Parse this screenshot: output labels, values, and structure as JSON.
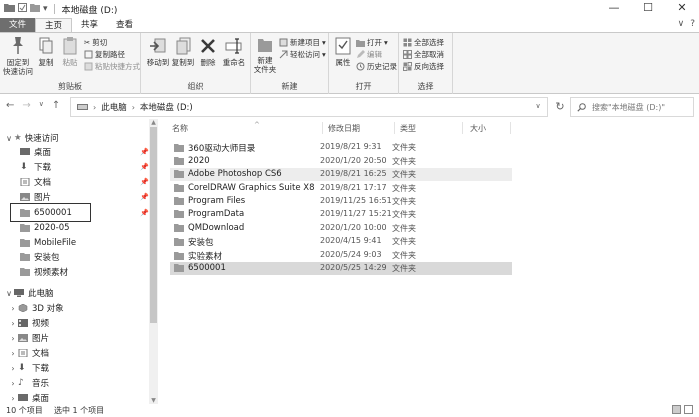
{
  "window": {
    "title": "本地磁盘 (D:)",
    "controls": [
      "—",
      "☐",
      "✕"
    ]
  },
  "quick_access_toolbar": [
    "save-icon",
    "properties-icon",
    "new-folder-icon"
  ],
  "tabs": [
    {
      "label": "文件"
    },
    {
      "label": "主页"
    },
    {
      "label": "共享"
    },
    {
      "label": "查看"
    }
  ],
  "ribbon": {
    "clipboard": {
      "label": "剪贴板",
      "pin": "固定到\n快速访问",
      "copy": "复制",
      "paste": "粘贴",
      "cut": "剪切",
      "copy_path": "复制路径",
      "paste_shortcut": "粘贴快捷方式"
    },
    "organize": {
      "label": "组织",
      "move_to": "移动到",
      "copy_to": "复制到",
      "delete": "删除",
      "rename": "重命名"
    },
    "new": {
      "label": "新建",
      "new_folder": "新建\n文件夹",
      "new_item": "新建项目",
      "easy_access": "轻松访问"
    },
    "open": {
      "label": "打开",
      "properties": "属性",
      "open": "打开",
      "edit": "编辑",
      "history": "历史记录"
    },
    "select": {
      "label": "选择",
      "select_all": "全部选择",
      "select_none": "全部取消",
      "invert": "反向选择"
    }
  },
  "address": {
    "crumbs": [
      "此电脑",
      "本地磁盘 (D:)"
    ],
    "search_placeholder": "搜索\"本地磁盘 (D:)\""
  },
  "nav": {
    "quick_access": "快速访问",
    "quick_items": [
      "桌面",
      "下载",
      "文档",
      "图片",
      "6500001",
      "2020-05",
      "MobileFile",
      "安装包",
      "视频素材"
    ],
    "this_pc": "此电脑",
    "pc_items": [
      "3D 对象",
      "视频",
      "图片",
      "文档",
      "下载",
      "音乐",
      "桌面"
    ]
  },
  "columns": {
    "name": "名称",
    "date": "修改日期",
    "type": "类型",
    "size": "大小"
  },
  "files": [
    {
      "name": "360驱动大师目录",
      "date": "2019/8/21 9:31",
      "type": "文件夹"
    },
    {
      "name": "2020",
      "date": "2020/1/20 20:50",
      "type": "文件夹"
    },
    {
      "name": "Adobe Photoshop CS6",
      "date": "2019/8/21 16:25",
      "type": "文件夹"
    },
    {
      "name": "CorelDRAW Graphics Suite X8",
      "date": "2019/8/21 17:17",
      "type": "文件夹"
    },
    {
      "name": "Program Files",
      "date": "2019/11/25 16:51",
      "type": "文件夹"
    },
    {
      "name": "ProgramData",
      "date": "2019/11/27 15:21",
      "type": "文件夹"
    },
    {
      "name": "QMDownload",
      "date": "2020/1/20 10:00",
      "type": "文件夹"
    },
    {
      "name": "安装包",
      "date": "2020/4/15 9:41",
      "type": "文件夹"
    },
    {
      "name": "实验素材",
      "date": "2020/5/24 9:03",
      "type": "文件夹"
    },
    {
      "name": "6500001",
      "date": "2020/5/25 14:29",
      "type": "文件夹"
    }
  ],
  "status": {
    "count": "10 个项目",
    "selected": "选中 1 个项目"
  },
  "colors": {
    "file_tab": "#6e6e6e",
    "ribbon_bg": "#f5f5f5",
    "selected_row": "#d9d9d9",
    "hover_row": "#ededed",
    "folder_icon": "#8a8a8a"
  }
}
